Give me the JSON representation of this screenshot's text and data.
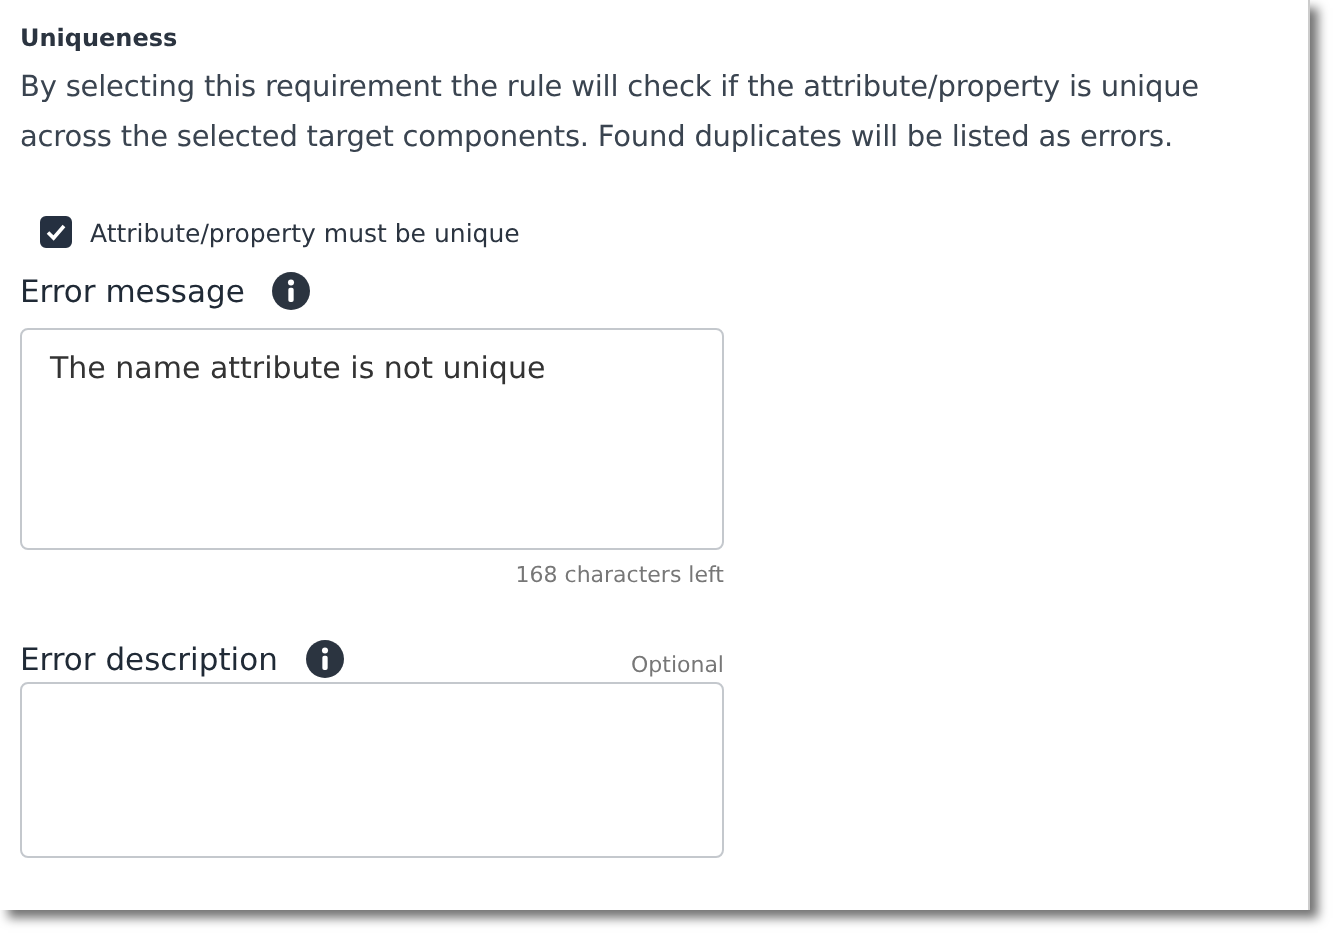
{
  "section": {
    "title": "Uniqueness",
    "description": "By selecting this requirement the rule will check if the attribute/property is unique across the selected target components. Found duplicates will be listed as errors.",
    "checkbox": {
      "label": "Attribute/property must be unique",
      "checked": true
    }
  },
  "fields": [
    {
      "label": "Error message",
      "value": "The name attribute is not unique",
      "counter": "168 characters left"
    },
    {
      "label": "Error description",
      "note": "Optional"
    }
  ]
}
